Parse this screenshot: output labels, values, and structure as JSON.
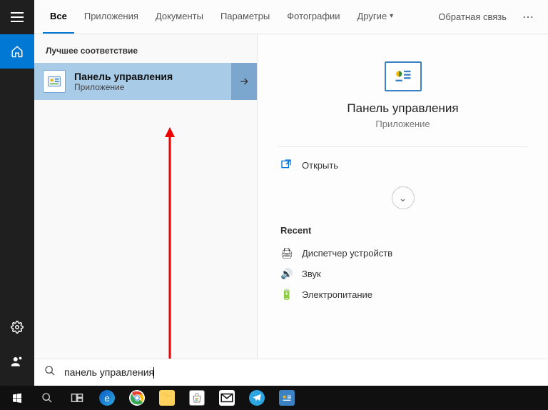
{
  "tabs": {
    "all": "Все",
    "apps": "Приложения",
    "docs": "Документы",
    "settings": "Параметры",
    "photos": "Фотографии",
    "more": "Другие",
    "feedback": "Обратная связь"
  },
  "results": {
    "best_match_header": "Лучшее соответствие",
    "item": {
      "title": "Панель управления",
      "subtitle": "Приложение"
    }
  },
  "preview": {
    "title": "Панель управления",
    "subtitle": "Приложение",
    "open_label": "Открыть",
    "recent_header": "Recent",
    "recent_items": [
      {
        "icon": "🖨",
        "label": "Диспетчер устройств"
      },
      {
        "icon": "🔊",
        "label": "Звук"
      },
      {
        "icon": "🔋",
        "label": "Электропитание"
      }
    ]
  },
  "search": {
    "query": "панель управления"
  }
}
